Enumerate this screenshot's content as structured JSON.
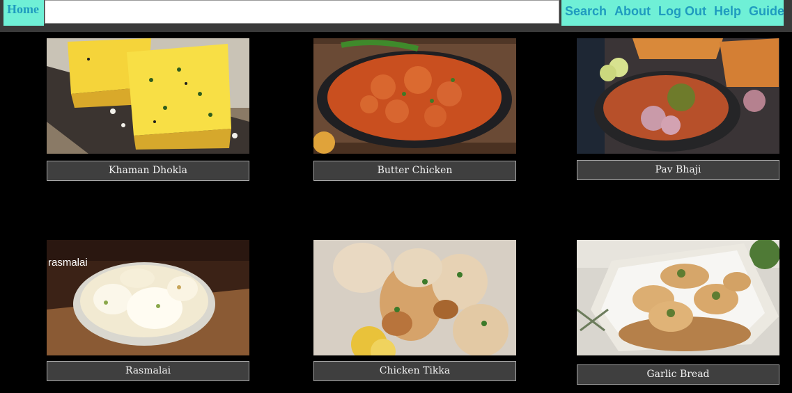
{
  "nav": {
    "home": "Home",
    "search_placeholder": "",
    "search_value": "",
    "links": [
      "Search",
      "About",
      "Log Out",
      "Help",
      "Guide"
    ]
  },
  "dishes": [
    {
      "name": "Khaman Dhokla",
      "image": "khaman-dhokla-photo"
    },
    {
      "name": "Butter Chicken",
      "image": "butter-chicken-photo"
    },
    {
      "name": "Pav Bhaji",
      "image": "pav-bhaji-photo"
    },
    {
      "name": "Rasmalai",
      "image": "rasmalai-photo",
      "overlay_text": "rasmalai"
    },
    {
      "name": "Chicken Tikka",
      "image": "chicken-tikka-photo"
    },
    {
      "name": "Garlic Bread",
      "image": "garlic-bread-photo"
    }
  ],
  "colors": {
    "nav_bg": "#6ff0d6",
    "nav_text": "#1f9bbf",
    "page_bg": "#000000",
    "caption_bg": "#3f3f3f"
  }
}
